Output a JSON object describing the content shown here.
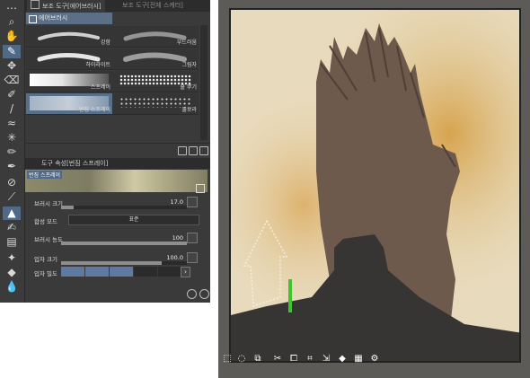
{
  "tabs": {
    "active": "보조 도구[에어브러시]",
    "inactive": "보조 도구[전체 스케터]"
  },
  "subtool_group": "에어브러시",
  "brushes": [
    {
      "label": "강함",
      "selected": false
    },
    {
      "label": "부드러움",
      "selected": false
    },
    {
      "label": "하이라이트",
      "selected": false
    },
    {
      "label": "그림자",
      "selected": false
    },
    {
      "label": "스프레이",
      "selected": false
    },
    {
      "label": "흩 뿌기",
      "selected": false
    },
    {
      "label": "번짐 스프레이",
      "selected": true
    },
    {
      "label": "물보라",
      "selected": false
    }
  ],
  "properties": {
    "tab_label": "도구 속성[번짐 스프레이]",
    "preview_label": "번짐 스프레이",
    "brush_size": {
      "label": "브러시 크기",
      "value": "17.0",
      "fraction": 0.1
    },
    "blend_mode": {
      "label": "합성 모드",
      "value": "표준"
    },
    "brush_density": {
      "label": "브러시 농도",
      "value": "100",
      "fraction": 1.0
    },
    "particle_size": {
      "label": "입자 크기",
      "value": "100.0",
      "fraction": 0.8
    },
    "particle_density": {
      "label": "입자 밀도"
    }
  },
  "colors": {
    "accent": "#4f6a86",
    "canvas_bg": "#e6d9b8",
    "orange": "#d49a3a",
    "tower": "#6e5a4c",
    "dark_mass": "#373533",
    "green": "#3ec42c"
  },
  "toolbar_icons": [
    "zoom-icon",
    "hand-icon",
    "pen-icon",
    "move-icon",
    "eraser-icon",
    "eyedropper-icon",
    "brush-icon",
    "blend-icon",
    "wand-icon",
    "pencil-icon",
    "marker-icon",
    "ink-icon",
    "airbrush-icon",
    "decoration-icon",
    "figure-icon",
    "fill-icon",
    "gradient-icon",
    "eraser2-icon",
    "blur-icon"
  ],
  "canvas_tools": [
    "select-all-icon",
    "lasso-icon",
    "invert-icon",
    "cut-icon",
    "copy-icon",
    "crop-icon",
    "transform-icon",
    "fill-icon",
    "checker-icon",
    "settings-icon"
  ]
}
